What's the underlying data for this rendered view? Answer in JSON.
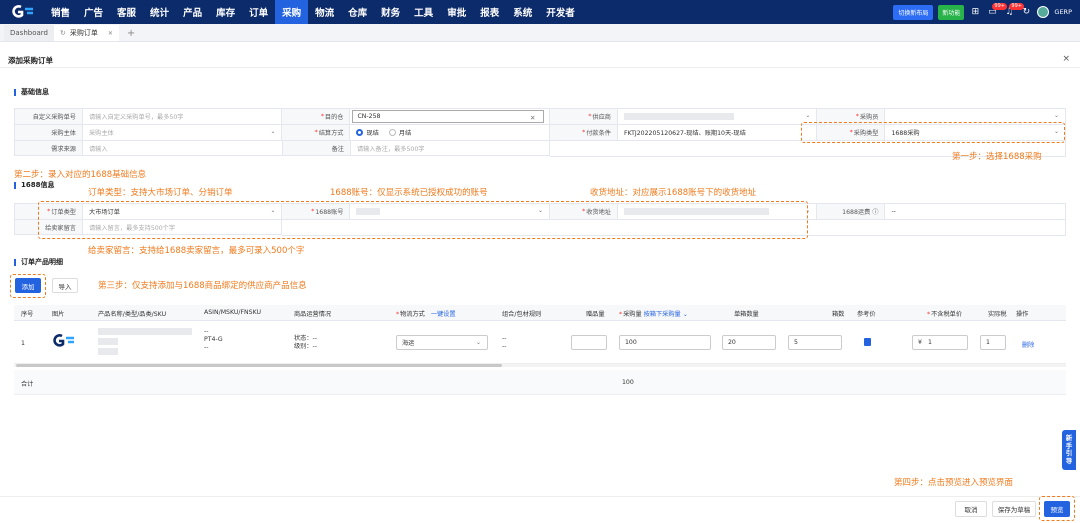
{
  "nav": {
    "items": [
      "销售",
      "广告",
      "客服",
      "统计",
      "产品",
      "库存",
      "订单",
      "采购",
      "物流",
      "仓库",
      "财务",
      "工具",
      "审批",
      "报表",
      "系统",
      "开发者"
    ],
    "active_index": 7,
    "switch_layout": "切换新布局",
    "new_feature": "新功能",
    "badge1": "99+",
    "badge2": "99+",
    "username": "GERP"
  },
  "tabs": {
    "dashboard": "Dashboard",
    "purchase_order": "采购订单",
    "add": "+"
  },
  "modal": {
    "title": "添加采购订单",
    "close": "×"
  },
  "basic": {
    "section_title": "基础信息",
    "custom_no_label": "自定义采购单号",
    "custom_no_placeholder": "请输入自定义采购单号，最多50字",
    "warehouse_label": "目的仓",
    "warehouse_value": "CN-258",
    "supplier_label": "供应商",
    "buyer_label": "采购员",
    "entity_label": "采购主体",
    "entity_placeholder": "采购主体",
    "settle_label": "结算方式",
    "settle_opt1": "现结",
    "settle_opt2": "月结",
    "pay_label": "付款条件",
    "pay_value": "FKTJ202205120627-现结、账期10天-现结",
    "type_label": "采购类型",
    "type_value": "1688采购",
    "source_label": "需求来源",
    "source_placeholder": "请输入",
    "remark_label": "备注",
    "remark_placeholder": "请输入备注，最多500字"
  },
  "info1688": {
    "section_title": "1688信息",
    "order_type_label": "订单类型",
    "order_type_value": "大市场订单",
    "account_label": "1688账号",
    "address_label": "收货地址",
    "freight_label": "1688运费",
    "freight_value": "--",
    "msg_label": "给卖家留言",
    "msg_placeholder": "请输入留言，最多支持500个字"
  },
  "annotations": {
    "step1": "第一步：选择1688采购",
    "step2": "第二步：录入对应的1688基础信息",
    "order_type": "订单类型：支持大市场订单、分销订单",
    "account": "1688账号：仅显示系统已授权成功的账号",
    "address": "收货地址：对应展示1688账号下的收货地址",
    "message": "给卖家留言：支持给1688卖家留言，最多可录入500个字",
    "step3": "第三步：仅支持添加与1688商品绑定的供应商产品信息",
    "step4": "第四步：点击预览进入预览界面"
  },
  "products": {
    "section_title": "订单产品明细",
    "add_button": "添加",
    "import_button": "导入",
    "columns": {
      "seq": "序号",
      "image": "图片",
      "name": "产品名称/类型/品类/SKU",
      "asin": "ASIN/MSKU/FNSKU",
      "ops": "商品运营情况",
      "shipping": "物流方式",
      "shipping_link": "一键设置",
      "combo": "组合/包材规则",
      "gift": "赠品量",
      "qty": "采购量",
      "qty_link": "按箱下采购量",
      "per_box": "单箱数量",
      "boxes": "箱数",
      "ref_price": "参考价",
      "unit_price": "不含税单价",
      "actual": "实际税",
      "action": "操作"
    },
    "rows": [
      {
        "seq": "1",
        "asin_line1": "--",
        "asin_line2": "PT4-G",
        "asin_line3": "--",
        "status_line1": "状态：--",
        "status_line2": "级别：--",
        "shipping": "海运",
        "combo1": "--",
        "combo2": "--",
        "qty": "100",
        "per_box": "20",
        "boxes": "5",
        "currency": "¥",
        "unit_price": "1",
        "actual": "1",
        "delete": "删除"
      }
    ],
    "total_label": "合计",
    "total_qty": "100"
  },
  "side_help": [
    "新",
    "手",
    "引",
    "导"
  ],
  "footer": {
    "cancel": "取消",
    "save_draft": "保存为草稿",
    "preview": "预览"
  }
}
